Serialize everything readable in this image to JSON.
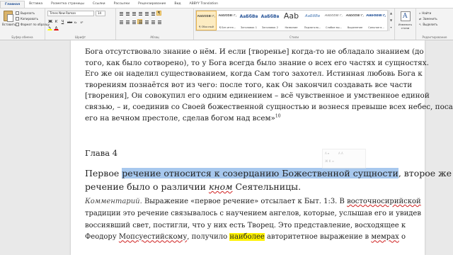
{
  "ribbon": {
    "tabs": [
      {
        "label": "Главная",
        "active": true
      },
      {
        "label": "Вставка"
      },
      {
        "label": "Разметка страницы"
      },
      {
        "label": "Ссылки"
      },
      {
        "label": "Рассылки"
      },
      {
        "label": "Рецензирование"
      },
      {
        "label": "Вид"
      },
      {
        "label": "ABBYY Translation"
      }
    ],
    "clipboard": {
      "paste": "Вставить",
      "cut": "Вырезать",
      "copy": "Копировать",
      "format_painter": "Формат по образцу",
      "group": "Буфер обмена"
    },
    "font": {
      "name": "Times New Roman",
      "size": "14",
      "bold": "Ж",
      "italic": "К",
      "underline": "Ч",
      "strike": "abc",
      "subscript": "x₂",
      "superscript": "x²",
      "text_color": "А",
      "group": "Шрифт"
    },
    "paragraph": {
      "group": "Абзац",
      "show_marks": "¶"
    },
    "styles": {
      "items": [
        {
          "sample": "АаБбВвГг,",
          "name": "¶ Обычный",
          "selected": true
        },
        {
          "sample": "АаБбВвГг,",
          "name": "¶ Без инте..."
        },
        {
          "sample": "АаБбВв",
          "name": "Заголовок 1"
        },
        {
          "sample": "АаБбВв",
          "name": "Заголовок 2"
        },
        {
          "sample": "Aab",
          "name": "Название"
        },
        {
          "sample": "АаБбВв",
          "name": "Подзаголо..."
        },
        {
          "sample": "АаБбВвГг,",
          "name": "Слабое вы..."
        },
        {
          "sample": "АаБбВвГг,",
          "name": "Выделение"
        },
        {
          "sample": "АаБбВвГг,",
          "name": "Сильное в..."
        }
      ],
      "group": "Стили"
    },
    "change_styles": "Изменить стили",
    "editing": {
      "find": "Найти",
      "replace": "Заменить",
      "select": "Выделить",
      "group": "Редактирование"
    }
  },
  "document": {
    "para1": [
      "Бога отсутствовало знание о нём. И если [творенье] когда-то не обладало знанием (до",
      "того, как было сотворено), то у Бога всегда было знание о всех его частях и сущностях.",
      "Его же он наделил существованием, когда Сам того захотел. Истинная любовь Бога к",
      "творениям познаётся вот из чего: после того, как Он закончил создавать все части",
      "[творения], Он совокупил его одним единением – всё чувственное и умственное единой",
      "связью, – и, соединив со Своей божественной сущностью и вознеся превыше всех небес, посадил"
    ],
    "para1_last": "его на вечном престоле, сделав богом над всем»",
    "para1_sup": "10",
    "heading": "Глава 4",
    "lead1_pre": "Первое ",
    "lead1_sel": "речение относится к созерцанию Божественной сущности",
    "lead1_post": ", второе же",
    "lead2_pre": "речение было о различии ",
    "lead2_wavy": "кном",
    "lead2_post": " Сеятельницы.",
    "comment_label": "Комментарий.",
    "comment_l1": " Выражение «первое речение» отсылает к Быт. 1:3. В ",
    "comment_l1_wavy": "восточносирийской",
    "comment_l2": "традиции это речение связывалось с научением ангелов, которые, услышав его и увидев",
    "comment_l3": "воссиявший свет, постигли, что у них есть Творец. Это представление, восходящее к",
    "comment_l4_pre": "Феодору ",
    "comment_l4_wavy": "Мопсуестийскому",
    "comment_l4_mid": ", получило ",
    "comment_l4_yel": "наиболее",
    "comment_l4_mid2": " авторитетное выражение в ",
    "comment_l4_wavy2": "мемрах",
    "comment_l4_post": " о"
  },
  "colors": {
    "accent": "#2b579a",
    "selection": "#a7c8ee",
    "highlight": "#fff200"
  }
}
